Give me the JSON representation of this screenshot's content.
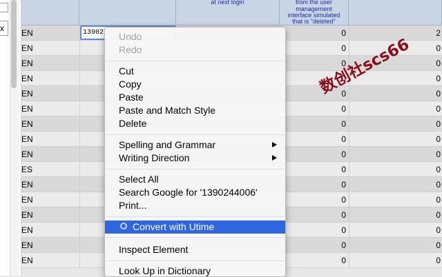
{
  "sidebar": {
    "close_glyph": "x"
  },
  "header": {
    "col_c_text": "at next login",
    "col_d_lines": [
      "from the user",
      "management",
      "interface simulated",
      "that is \"deleted\""
    ]
  },
  "rows": [
    {
      "code": "EN",
      "count": "0",
      "total": "2"
    },
    {
      "code": "EN",
      "count": "0",
      "total": "0"
    },
    {
      "code": "EN",
      "count": "0",
      "total": "0"
    },
    {
      "code": "EN",
      "count": "0",
      "total": "0"
    },
    {
      "code": "EN",
      "count": "0",
      "total": "0"
    },
    {
      "code": "EN",
      "count": "0",
      "total": "0"
    },
    {
      "code": "EN",
      "count": "0",
      "total": "0"
    },
    {
      "code": "EN",
      "count": "0",
      "total": "0"
    },
    {
      "code": "EN",
      "count": "0",
      "total": "0"
    },
    {
      "code": "ES",
      "count": "0",
      "total": "0"
    },
    {
      "code": "EN",
      "count": "0",
      "total": "0"
    },
    {
      "code": "EN",
      "count": "0",
      "total": "0"
    },
    {
      "code": "EN",
      "count": "0",
      "total": "0"
    },
    {
      "code": "EN",
      "count": "0",
      "total": "0"
    },
    {
      "code": "EN",
      "count": "0",
      "total": "0"
    },
    {
      "code": "EN",
      "count": "0",
      "total": "0"
    }
  ],
  "editing_cell": {
    "value": "13902"
  },
  "context_menu": {
    "undo": "Undo",
    "redo": "Redo",
    "cut": "Cut",
    "copy": "Copy",
    "paste": "Paste",
    "paste_match": "Paste and Match Style",
    "delete": "Delete",
    "spelling": "Spelling and Grammar",
    "writing_direction": "Writing Direction",
    "select_all": "Select All",
    "search_google": "Search Google for '1390244006'",
    "print": "Print...",
    "convert_utime": "Convert with Utime",
    "inspect": "Inspect Element",
    "lookup": "Look Up in Dictionary"
  },
  "watermark": {
    "text": "数创社scs66",
    "color": "#8c0d1b"
  },
  "colors": {
    "highlight": "#2f66df",
    "header_bg": "#c9d4e4",
    "header_text": "#1a2fa8"
  }
}
